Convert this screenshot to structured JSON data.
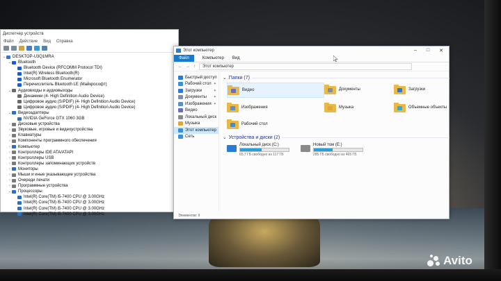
{
  "device_manager": {
    "title": "Диспетчер устройств",
    "menu": [
      "Файл",
      "Действие",
      "Вид",
      "Справка"
    ],
    "tree": [
      {
        "label": "DESKTOP-U3Q1MRA",
        "level": 0,
        "expanded": true,
        "icon_color": "#3b74c6"
      },
      {
        "label": "Bluetooth",
        "level": 1,
        "expanded": true,
        "icon_color": "#1e5bd2"
      },
      {
        "label": "Bluetooth Device (RFCOMM Protocol TDI)",
        "level": 2,
        "icon_color": "#1e5bd2"
      },
      {
        "label": "Intel(R) Wireless Bluetooth(R)",
        "level": 2,
        "icon_color": "#1e5bd2"
      },
      {
        "label": "Microsoft Bluetooth Enumerator",
        "level": 2,
        "icon_color": "#1e5bd2"
      },
      {
        "label": "Перечислитель Bluetooth LE (Майкрософт)",
        "level": 2,
        "icon_color": "#1e5bd2"
      },
      {
        "label": "Аудиовходы и аудиовыходы",
        "level": 1,
        "expanded": true,
        "icon_color": "#6a6a6a"
      },
      {
        "label": "Динамики (4- High Definition Audio Device)",
        "level": 2,
        "icon_color": "#6a6a6a"
      },
      {
        "label": "Цифровое аудио (S/PDIF) (4- High Definition Audio Device)",
        "level": 2,
        "icon_color": "#6a6a6a"
      },
      {
        "label": "Цифровое аудио (S/PDIF) (4- High Definition Audio Device)",
        "level": 2,
        "icon_color": "#6a6a6a"
      },
      {
        "label": "Видеоадаптеры",
        "level": 1,
        "expanded": true,
        "icon_color": "#2e6fbf"
      },
      {
        "label": "NVIDIA GeForce GTX 1060 3GB",
        "level": 2,
        "icon_color": "#2e6fbf"
      },
      {
        "label": "Дисковые устройства",
        "level": 1,
        "icon_color": "#7a7a7a"
      },
      {
        "label": "Звуковые, игровые и видеоустройства",
        "level": 1,
        "icon_color": "#7a7a7a"
      },
      {
        "label": "Клавиатуры",
        "level": 1,
        "icon_color": "#7a7a7a"
      },
      {
        "label": "Компоненты программного обеспечения",
        "level": 1,
        "icon_color": "#7a7a7a"
      },
      {
        "label": "Компьютер",
        "level": 1,
        "icon_color": "#2e6fbf"
      },
      {
        "label": "Контроллеры IDE ATA/ATAPI",
        "level": 1,
        "icon_color": "#7a7a7a"
      },
      {
        "label": "Контроллеры USB",
        "level": 1,
        "icon_color": "#7a7a7a"
      },
      {
        "label": "Контроллеры запоминающих устройств",
        "level": 1,
        "icon_color": "#7a7a7a"
      },
      {
        "label": "Мониторы",
        "level": 1,
        "icon_color": "#2e6fbf"
      },
      {
        "label": "Мыши и иные указывающие устройства",
        "level": 1,
        "icon_color": "#7a7a7a"
      },
      {
        "label": "Очереди печати",
        "level": 1,
        "icon_color": "#7a7a7a"
      },
      {
        "label": "Программные устройства",
        "level": 1,
        "icon_color": "#7a7a7a"
      },
      {
        "label": "Процессоры",
        "level": 1,
        "expanded": true,
        "icon_color": "#2e6fbf"
      },
      {
        "label": "Intel(R) Core(TM) i5-7400 CPU @ 3.00GHz",
        "level": 2,
        "icon_color": "#2e6fbf"
      },
      {
        "label": "Intel(R) Core(TM) i5-7400 CPU @ 3.00GHz",
        "level": 2,
        "icon_color": "#2e6fbf"
      },
      {
        "label": "Intel(R) Core(TM) i5-7400 CPU @ 3.00GHz",
        "level": 2,
        "icon_color": "#2e6fbf"
      },
      {
        "label": "Intel(R) Core(TM) i5-7400 CPU @ 3.00GHz",
        "level": 2,
        "icon_color": "#2e6fbf"
      }
    ]
  },
  "explorer": {
    "title": "Этот компьютер",
    "ribbon_tabs": [
      "Файл",
      "Компьютер",
      "Вид"
    ],
    "address": "Этот компьютер",
    "nav": [
      {
        "label": "Быстрый доступ",
        "icon_color": "#2a7bd3",
        "pinned": false
      },
      {
        "label": "Рабочий стол",
        "icon_color": "#3c8fd6",
        "pinned": true
      },
      {
        "label": "Загрузки",
        "icon_color": "#2a7bd3",
        "pinned": true
      },
      {
        "label": "Документы",
        "icon_color": "#7f8fa6",
        "pinned": true
      },
      {
        "label": "Изображения",
        "icon_color": "#5a8fc7",
        "pinned": true
      },
      {
        "label": "Видео",
        "icon_color": "#6a6fb8",
        "pinned": false
      },
      {
        "label": "Локальный диск",
        "icon_color": "#8a8a8a",
        "pinned": false
      },
      {
        "label": "Музыка",
        "icon_color": "#e0a732",
        "pinned": false
      },
      {
        "label": "Этот компьютер",
        "icon_color": "#3c8fd6",
        "pinned": false,
        "selected": true
      },
      {
        "label": "Сеть",
        "icon_color": "#3c8fd6",
        "pinned": false
      }
    ],
    "folders_header": "Папки (7)",
    "folders": [
      {
        "label": "Видео",
        "glyph_color": "#6a6fb8",
        "selected": true
      },
      {
        "label": "Документы",
        "glyph_color": "#7f8fa6"
      },
      {
        "label": "Загрузки",
        "glyph_color": "#2a7bd3"
      },
      {
        "label": "Изображения",
        "glyph_color": "#5a8fc7"
      },
      {
        "label": "Музыка",
        "glyph_color": "#e0a732"
      },
      {
        "label": "Объемные объекты",
        "glyph_color": "#2ab0d9"
      },
      {
        "label": "Рабочий стол",
        "glyph_color": "#3c8fd6"
      }
    ],
    "drives_header": "Устройства и диски (2)",
    "drives": [
      {
        "name": "Локальный диск (C:)",
        "free": "65,7 ГБ свободно из 117 ГБ",
        "used_fraction": 0.44,
        "icon_color": "#2a7bd3"
      },
      {
        "name": "Новый том (E:)",
        "free": "285 ГБ свободно из 465 ГБ",
        "used_fraction": 0.39,
        "icon_color": "#8a8a8a"
      }
    ],
    "status": "Элементов: 9"
  },
  "watermark": {
    "text": "Avito"
  }
}
